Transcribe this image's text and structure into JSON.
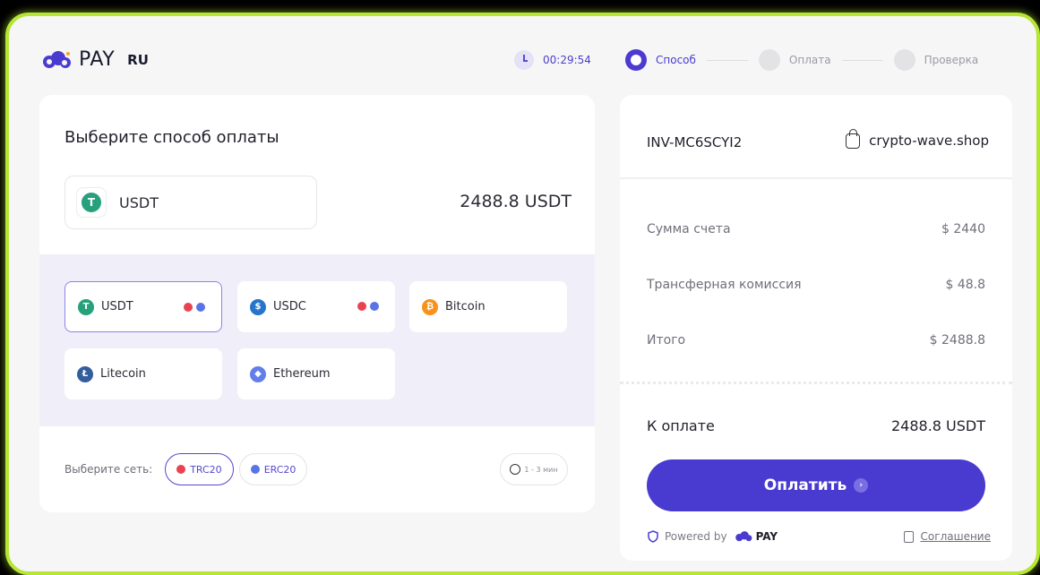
{
  "header": {
    "brand": "PAY",
    "lang": "RU",
    "timer": "00:29:54",
    "steps": [
      {
        "label": "Способ",
        "active": true
      },
      {
        "label": "Оплата",
        "active": false
      },
      {
        "label": "Проверка",
        "active": false
      }
    ]
  },
  "left": {
    "title": "Выберите способ оплаты",
    "selected": {
      "name": "USDT",
      "amount": "2488.8 USDT"
    },
    "methods": [
      {
        "name": "USDT",
        "icon": "tether-icon",
        "color": "#26a17b",
        "selected": true
      },
      {
        "name": "USDC",
        "icon": "usdc-icon",
        "color": "#2775ca",
        "selected": false
      },
      {
        "name": "Bitcoin",
        "icon": "bitcoin-icon",
        "color": "#f7931a",
        "selected": false
      },
      {
        "name": "Litecoin",
        "icon": "litecoin-icon",
        "color": "#345d9d",
        "selected": false
      },
      {
        "name": "Ethereum",
        "icon": "ethereum-icon",
        "color": "#627eea",
        "selected": false
      }
    ],
    "network_label": "Выберите сеть:",
    "networks": [
      {
        "name": "TRC20",
        "color": "#e8434f",
        "selected": true
      },
      {
        "name": "ERC20",
        "color": "#5a74e6",
        "selected": false
      }
    ],
    "eta": "1 - 3 мин"
  },
  "right": {
    "invoice": "INV-MC6SCYI2",
    "shop": "crypto-wave.shop",
    "rows": [
      {
        "label": "Сумма счета",
        "value": "$ 2440"
      },
      {
        "label": "Трансферная комиссия",
        "value": "$ 48.8"
      },
      {
        "label": "Итого",
        "value": "$ 2488.8"
      }
    ],
    "total_label": "К оплате",
    "total_value": "2488.8 USDT",
    "pay_button": "Оплатить",
    "powered_by": "Powered by",
    "powered_brand": "PAY",
    "agreement": "Соглашение"
  },
  "colors": {
    "accent": "#4a3bd0",
    "frame": "#b6e634"
  }
}
